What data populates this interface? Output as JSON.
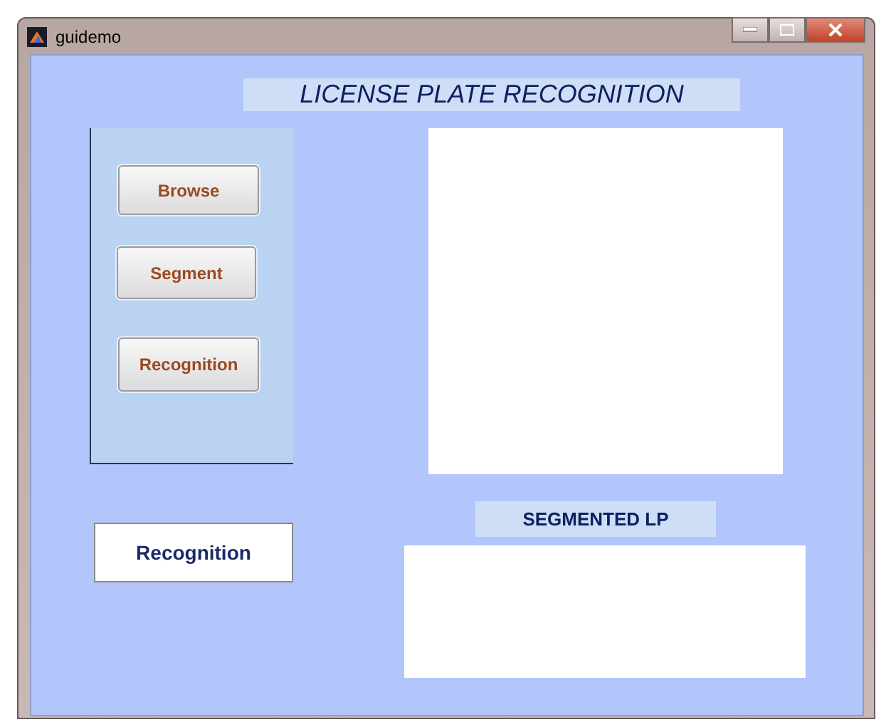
{
  "window": {
    "title": "guidemo"
  },
  "title_label": "LICENSE PLATE RECOGNITION",
  "buttons": [
    "Browse",
    "Segment",
    "Recognition"
  ],
  "result": "Recognition",
  "segmented_label": "SEGMENTED LP"
}
